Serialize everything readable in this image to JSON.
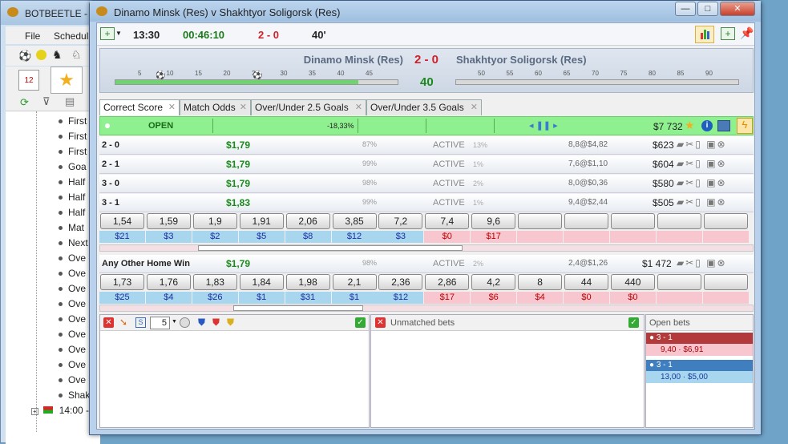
{
  "bg_app": {
    "title": "BOTBEETLE - 5",
    "menu": [
      "File",
      "Schedul"
    ],
    "tree_items": [
      "First",
      "First",
      "First",
      "Goa",
      "Half",
      "Half",
      "Half",
      "Mat",
      "Next",
      "Ove",
      "Ove",
      "Ove",
      "Ove",
      "Ove",
      "Ove",
      "Ove",
      "Ove",
      "Ove",
      "Shak"
    ],
    "tree_last": "14:00 -",
    "calendar_num": "12"
  },
  "window": {
    "title": "Dinamo Minsk (Res) v Shakhtyor Soligorsk (Res)",
    "min": "—",
    "max": "□",
    "close": "✕"
  },
  "toolbar": {
    "start_time": "13:30",
    "elapsed": "00:46:10",
    "score": "2 - 0",
    "minute": "40'"
  },
  "scoreboard": {
    "home": "Dinamo Minsk (Res)",
    "score": "2 - 0",
    "away": "Shakhtyor Soligorsk (Res)",
    "minute": "40",
    "first_half_ticks": [
      "5",
      "10",
      "15",
      "20",
      "25",
      "30",
      "35",
      "40",
      "45"
    ],
    "second_half_ticks": [
      "50",
      "55",
      "60",
      "65",
      "70",
      "75",
      "80",
      "85",
      "90"
    ],
    "first_half_progress": 0.86,
    "goal_icon": "soccer-ball-icon"
  },
  "tabs": [
    {
      "label": "Correct Score",
      "active": true
    },
    {
      "label": "Match Odds"
    },
    {
      "label": "Over/Under 2.5 Goals"
    },
    {
      "label": "Over/Under 3.5 Goals"
    }
  ],
  "market_header": {
    "status": "OPEN",
    "overround": "-18,33%",
    "balance": "$7 732"
  },
  "runners": [
    {
      "name": "2 - 0",
      "price": "$1,79",
      "pct": "87%",
      "status": "ACTIVE",
      "pct2": "13%",
      "info": "8,8@$4,82",
      "amount": "$623"
    },
    {
      "name": "2 - 1",
      "price": "$1,79",
      "pct": "99%",
      "status": "ACTIVE",
      "pct2": "1%",
      "info": "7,6@$1,10",
      "amount": "$604"
    },
    {
      "name": "3 - 0",
      "price": "$1,79",
      "pct": "98%",
      "status": "ACTIVE",
      "pct2": "2%",
      "info": "8,0@$0,36",
      "amount": "$580"
    },
    {
      "name": "3 - 1",
      "price": "$1,83",
      "pct": "99%",
      "status": "ACTIVE",
      "pct2": "1%",
      "info": "9,4@$2,44",
      "amount": "$505"
    }
  ],
  "ladder1": {
    "odds": [
      "1,54",
      "1,59",
      "1,9",
      "1,91",
      "2,06",
      "3,85",
      "7,2",
      "7,4",
      "9,6",
      "",
      "",
      "",
      "",
      ""
    ],
    "stakes_back": [
      "$21",
      "$3",
      "$2",
      "$5",
      "$8",
      "$12",
      "$3"
    ],
    "stakes_lay": [
      "$0",
      "$17"
    ]
  },
  "runner_other": {
    "name": "Any Other Home Win",
    "price": "$1,79",
    "pct": "98%",
    "status": "ACTIVE",
    "pct2": "2%",
    "info": "2,4@$1,26",
    "amount": "$1 472"
  },
  "ladder2": {
    "odds": [
      "1,73",
      "1,76",
      "1,83",
      "1,84",
      "1,98",
      "2,1",
      "2,36",
      "2,86",
      "4,2",
      "8",
      "44",
      "440",
      "",
      ""
    ],
    "stakes_back": [
      "$25",
      "$4",
      "$26",
      "$1",
      "$31",
      "$1",
      "$12"
    ],
    "stakes_lay": [
      "$17",
      "$6",
      "$4",
      "$0",
      "$0"
    ]
  },
  "bottom": {
    "stake_value": "5",
    "unmatched_label": "Unmatched bets",
    "open_label": "Open bets",
    "open_bets": [
      {
        "name": "3 - 1",
        "detail": "9,40 · $6,91",
        "side": "lay",
        "color": "#c04040"
      },
      {
        "name": "3 - 1",
        "detail": "13,00 · $5,00",
        "side": "back",
        "color": "#3f7fbf"
      }
    ]
  },
  "colors": {
    "open_green": "#8ef08e",
    "price_green": "#1a8a1a",
    "score_red": "#d0202a",
    "back_blue": "#a8d6ee",
    "lay_pink": "#f8c6cf"
  }
}
